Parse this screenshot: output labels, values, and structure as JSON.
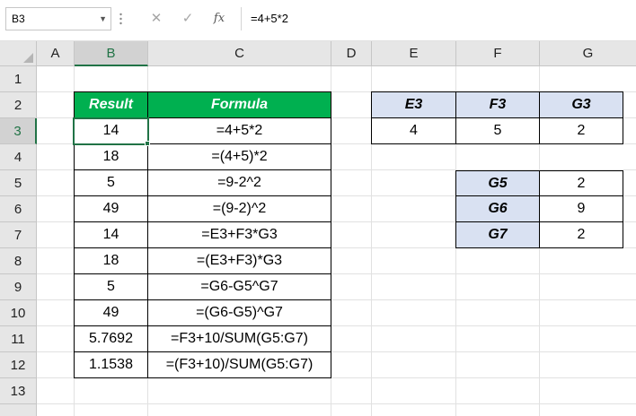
{
  "formula_bar": {
    "name_box": "B3",
    "cancel_icon": "✕",
    "enter_icon": "✓",
    "fx_label": "fx",
    "formula": "=4+5*2"
  },
  "columns": [
    "A",
    "B",
    "C",
    "D",
    "E",
    "F",
    "G"
  ],
  "rows": [
    "1",
    "2",
    "3",
    "4",
    "5",
    "6",
    "7",
    "8",
    "9",
    "10",
    "11",
    "12",
    "13"
  ],
  "selected_cell": "B3",
  "table1": {
    "headers": {
      "result": "Result",
      "formula": "Formula"
    },
    "rows": [
      {
        "result": "14",
        "formula": "=4+5*2"
      },
      {
        "result": "18",
        "formula": "=(4+5)*2"
      },
      {
        "result": "5",
        "formula": "=9-2^2"
      },
      {
        "result": "49",
        "formula": "=(9-2)^2"
      },
      {
        "result": "14",
        "formula": "=E3+F3*G3"
      },
      {
        "result": "18",
        "formula": "=(E3+F3)*G3"
      },
      {
        "result": "5",
        "formula": "=G6-G5^G7"
      },
      {
        "result": "49",
        "formula": "=(G6-G5)^G7"
      },
      {
        "result": "5.7692",
        "formula": "=F3+10/SUM(G5:G7)"
      },
      {
        "result": "1.1538",
        "formula": "=(F3+10)/SUM(G5:G7)"
      }
    ]
  },
  "table2": {
    "headers": [
      "E3",
      "F3",
      "G3"
    ],
    "values": [
      "4",
      "5",
      "2"
    ]
  },
  "table3": {
    "rows": [
      {
        "label": "G5",
        "value": "2"
      },
      {
        "label": "G6",
        "value": "9"
      },
      {
        "label": "G7",
        "value": "2"
      }
    ]
  },
  "colors": {
    "accent": "#217346",
    "header_green": "#00b050",
    "header_blue": "#d9e1f2",
    "gridline": "#e1e1e1"
  }
}
